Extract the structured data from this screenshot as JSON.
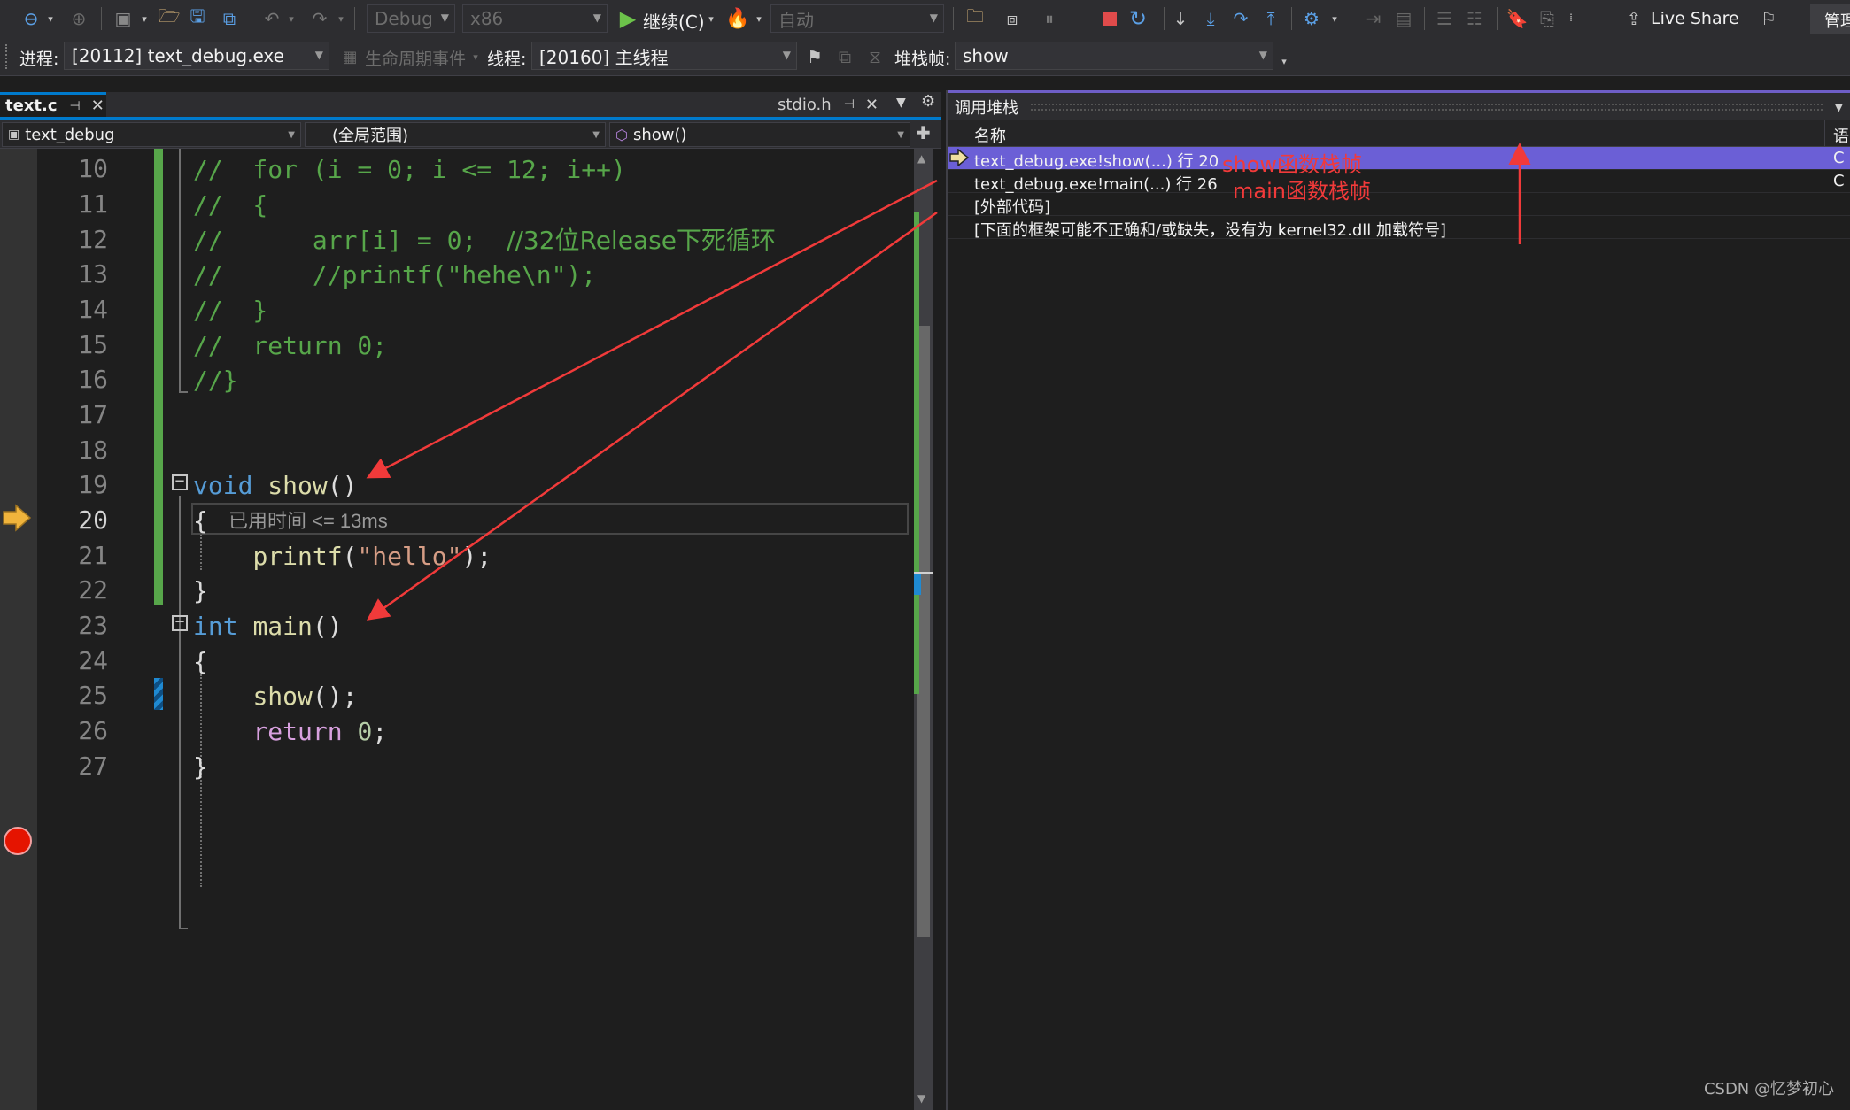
{
  "toolbar": {
    "config": "Debug",
    "platform": "x86",
    "continue_label": "继续(C)",
    "auto_label": "自动",
    "liveshare_label": "Live Share",
    "manage_label": "管理"
  },
  "toolbar2": {
    "process_label": "进程:",
    "process_value": "[20112] text_debug.exe",
    "lifecycle_label": "生命周期事件",
    "thread_label": "线程:",
    "thread_value": "[20160] 主线程",
    "stackframe_label": "堆栈帧:",
    "stackframe_value": "show"
  },
  "tabs": {
    "active": "text.c",
    "other": "stdio.h"
  },
  "navbar": {
    "project": "text_debug",
    "scope": "(全局范围)",
    "member": "show()"
  },
  "editor": {
    "line_numbers": [
      "10",
      "11",
      "12",
      "13",
      "14",
      "15",
      "16",
      "17",
      "18",
      "19",
      "20",
      "21",
      "22",
      "23",
      "24",
      "25",
      "26",
      "27"
    ],
    "perf_tip": "已用时间 <= 13ms",
    "lines": {
      "l10": "//  for (i = 0; i <= 12; i++)",
      "l11": "//  {",
      "l12_a": "//      arr[i] = 0;  ",
      "l12_b": "//32位Release下死循环",
      "l13": "//      //printf(\"hehe\\n\");",
      "l14": "//  }",
      "l15": "//  return 0;",
      "l16": "//}",
      "l19_kw": "void",
      "l19_fn": "show",
      "l20": "{",
      "l21_fn": "printf",
      "l21_str": "\"hello\"",
      "l22": "}",
      "l23_kw": "int",
      "l23_fn": "main",
      "l24": "{",
      "l25_fn": "show",
      "l26_kw": "return",
      "l26_num": "0",
      "l27": "}",
      "parens": "()",
      "semi": ";",
      "call_semi": "();",
      "open_paren": "(",
      "close_semi": ");"
    }
  },
  "callstack": {
    "title": "调用堆栈",
    "col_name": "名称",
    "col_lang": "语",
    "rows": [
      {
        "name": "text_debug.exe!show(...) 行 20",
        "lang": "C"
      },
      {
        "name": "text_debug.exe!main(...) 行 26",
        "lang": "C"
      },
      {
        "name": "[外部代码]",
        "lang": ""
      },
      {
        "name": "[下面的框架可能不正确和/或缺失，没有为 kernel32.dll 加载符号]",
        "lang": ""
      }
    ],
    "annotation_show": "show函数栈帧",
    "annotation_main": "main函数栈帧"
  },
  "colors": {
    "accent": "#007acc",
    "selection": "#6b5fd6",
    "annotation": "#f13a3a",
    "breakpoint": "#e51400",
    "current_arrow": "#f0b43c"
  },
  "watermark": "CSDN @忆梦初心"
}
